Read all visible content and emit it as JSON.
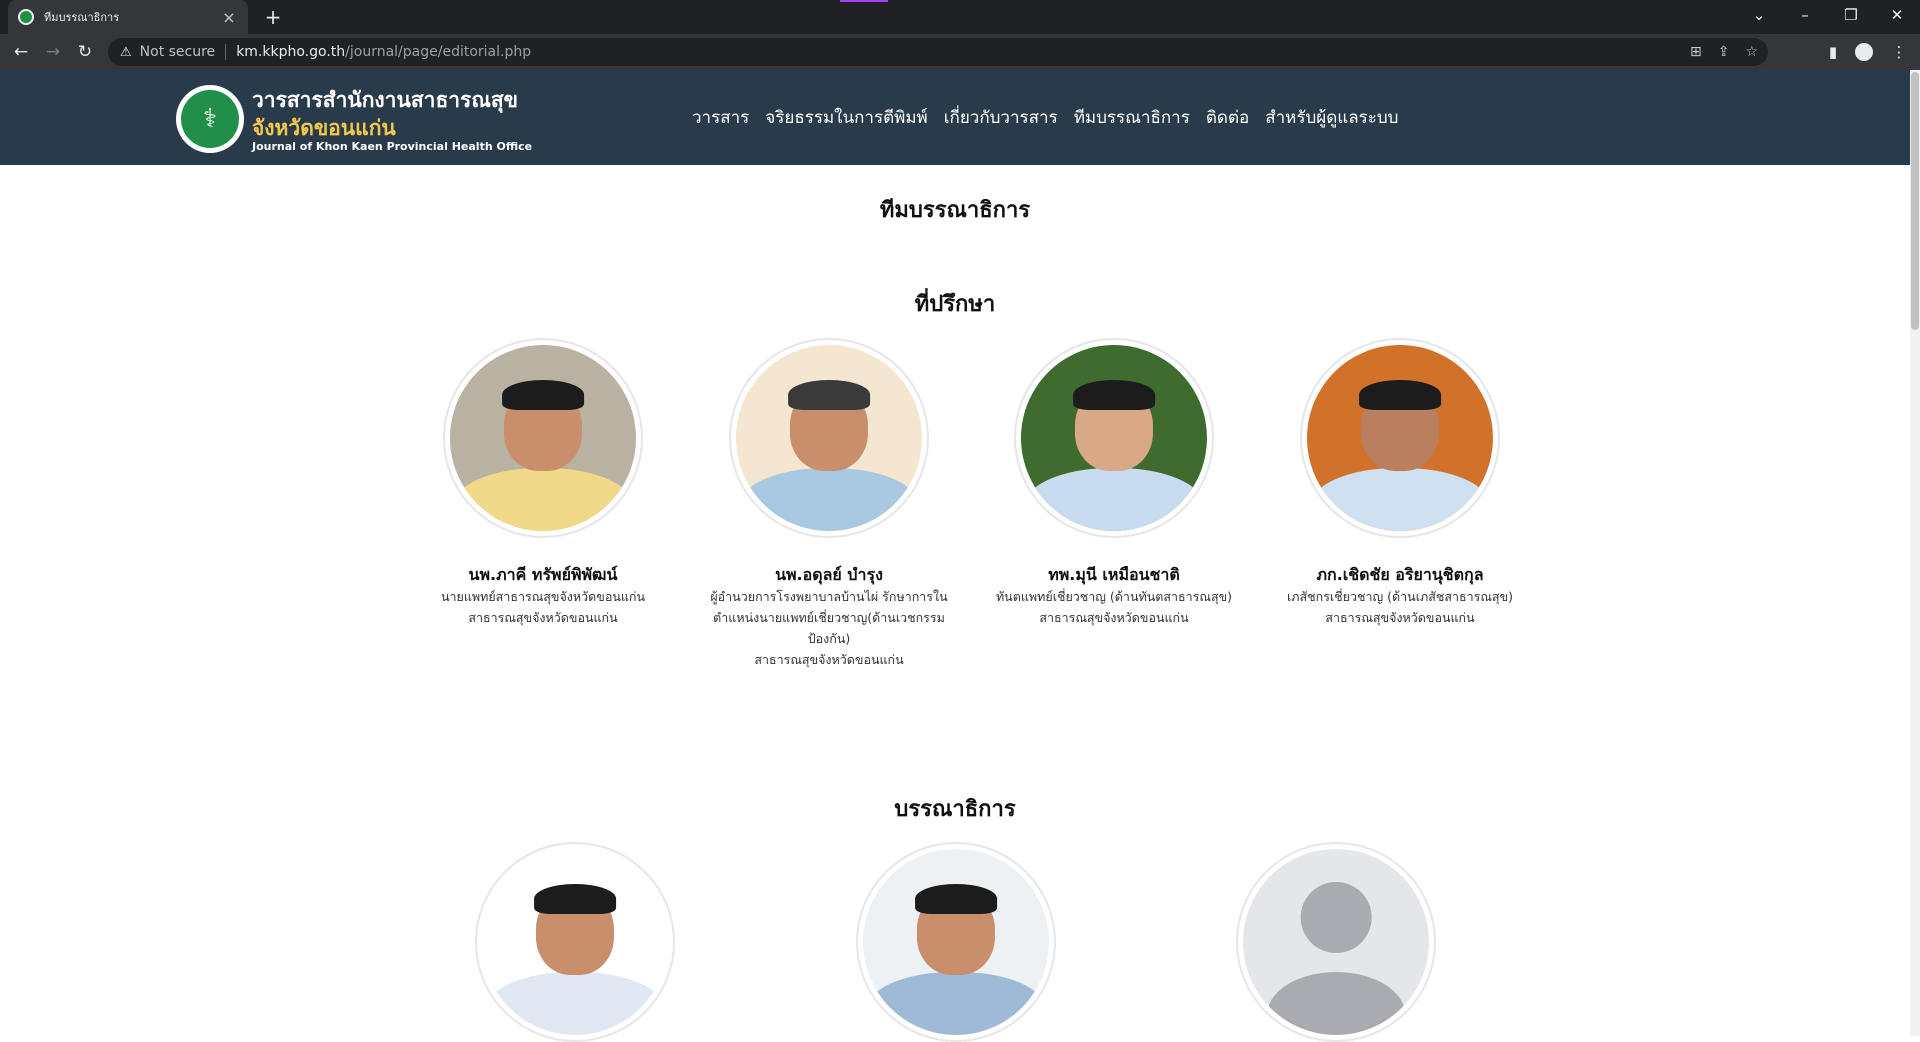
{
  "browser": {
    "tab_title": "ทีมบรรณาธิการ",
    "new_tab_symbol": "+",
    "security_label": "Not secure",
    "url_host": "km.kkpho.go.th",
    "url_path": "/journal/page/editorial.php",
    "icons": [
      "back-icon",
      "forward-icon",
      "reload-icon",
      "warning-icon",
      "translate-icon",
      "share-icon",
      "star-icon",
      "sidepanel-icon",
      "profile-icon",
      "menu-icon"
    ]
  },
  "site": {
    "brand_line1": "วารสารสำนักงานสาธารณสุข",
    "brand_line2": "จังหวัดขอนแก่น",
    "brand_line3": "Journal of Khon Kaen Provincial Health Office",
    "colors": {
      "header": "#293a4a",
      "brand_accent": "#f2c94c",
      "logo_green": "#1f8f4a"
    },
    "nav": [
      {
        "label": "วารสาร"
      },
      {
        "label": "จริยธรรมในการตีพิมพ์"
      },
      {
        "label": "เกี่ยวกับวารสาร"
      },
      {
        "label": "ทีมบรรณาธิการ"
      },
      {
        "label": "ติดต่อ"
      },
      {
        "label": "สำหรับผู้ดูแลระบบ"
      }
    ]
  },
  "page": {
    "title": "ทีมบรรณาธิการ",
    "advisors": {
      "heading": "ที่ปรึกษา",
      "people": [
        {
          "name": "นพ.ภาคี ทรัพย์พิพัฒน์",
          "role": "นายแพทย์สาธารณสุขจังหวัดขอนแก่น",
          "org": "สาธารณสุขจังหวัดขอนแก่น"
        },
        {
          "name": "นพ.อดุลย์ บำรุง",
          "role": "ผู้อำนวยการโรงพยาบาลบ้านไผ่ รักษาการในตำแหน่งนายแพทย์เชี่ยวชาญ(ด้านเวชกรรมป้องกัน)",
          "org": "สาธารณสุขจังหวัดขอนแก่น"
        },
        {
          "name": "ทพ.มุนี เหมือนชาติ",
          "role": "ทันตแพทย์เชี่ยวชาญ (ด้านทันตสาธารณสุข)",
          "org": "สาธารณสุขจังหวัดขอนแก่น"
        },
        {
          "name": "ภก.เชิดชัย อริยานุชิตกุล",
          "role": "เภสัชกรเชี่ยวชาญ (ด้านเภสัชสาธารณสุข)",
          "org": "สาธารณสุขจังหวัดขอนแก่น"
        }
      ]
    },
    "editors": {
      "heading": "บรรณาธิการ"
    }
  }
}
